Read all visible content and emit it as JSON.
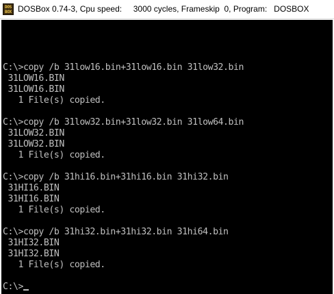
{
  "window": {
    "title": "DOSBox 0.74-3, Cpu speed:     3000 cycles, Frameskip  0, Program:   DOSBOX",
    "icon": "dosbox-icon",
    "icon_text": [
      "DOS",
      "BOX"
    ]
  },
  "console": {
    "text_color": "#c0c0c0",
    "background": "#000000",
    "lines": [
      "C:\\>copy /b 31low16.bin+31low16.bin 31low32.bin",
      " 31LOW16.BIN",
      " 31LOW16.BIN",
      "   1 File(s) copied.",
      "",
      "C:\\>copy /b 31low32.bin+31low32.bin 31low64.bin",
      " 31LOW32.BIN",
      " 31LOW32.BIN",
      "   1 File(s) copied.",
      "",
      "C:\\>copy /b 31hi16.bin+31hi16.bin 31hi32.bin",
      " 31HI16.BIN",
      " 31HI16.BIN",
      "   1 File(s) copied.",
      "",
      "C:\\>copy /b 31hi32.bin+31hi32.bin 31hi64.bin",
      " 31HI32.BIN",
      " 31HI32.BIN",
      "   1 File(s) copied.",
      ""
    ],
    "prompt": "C:\\>"
  }
}
